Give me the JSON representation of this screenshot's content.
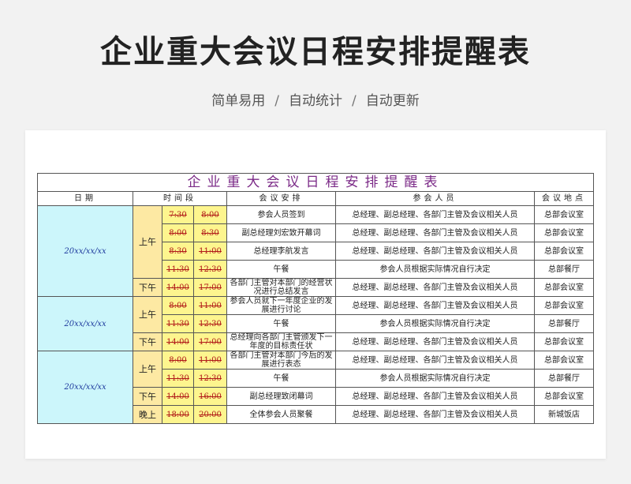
{
  "header": {
    "title": "企业重大会议日程安排提醒表",
    "subtitle": [
      "简单易用",
      "自动统计",
      "自动更新"
    ],
    "separator": "/"
  },
  "sheet": {
    "title": "企业重大会议日程安排提醒表",
    "columns": {
      "date": "日期",
      "time": "时间段",
      "agenda": "会议安排",
      "people": "参会人员",
      "location": "会议地点"
    },
    "days": [
      {
        "date": "20xx/xx/xx",
        "rows": [
          {
            "period": "上午",
            "start": "7:30",
            "end": "8:00",
            "agenda": "参会人员签到",
            "people": "总经理、副总经理、各部门主管及会议相关人员",
            "location": "总部会议室"
          },
          {
            "period": "",
            "start": "8:00",
            "end": "8:30",
            "agenda": "副总经理刘宏致开幕词",
            "people": "总经理、副总经理、各部门主管及会议相关人员",
            "location": "总部会议室"
          },
          {
            "period": "",
            "start": "8:30",
            "end": "11:00",
            "agenda": "总经理李航发言",
            "people": "总经理、副总经理、各部门主管及会议相关人员",
            "location": "总部会议室"
          },
          {
            "period": "",
            "start": "11:30",
            "end": "12:30",
            "agenda": "午餐",
            "people": "参会人员根据实际情况自行决定",
            "location": "总部餐厅"
          },
          {
            "period": "下午",
            "start": "14:00",
            "end": "17:00",
            "agenda": "各部门主管对本部门的经营状况进行总结发言",
            "people": "总经理、副总经理、各部门主管及会议相关人员",
            "location": "总部会议室"
          }
        ]
      },
      {
        "date": "20xx/xx/xx",
        "rows": [
          {
            "period": "上午",
            "start": "8:00",
            "end": "11:00",
            "agenda": "参会人员就下一年度企业的发展进行讨论",
            "people": "总经理、副总经理、各部门主管及会议相关人员",
            "location": "总部会议室"
          },
          {
            "period": "",
            "start": "11:30",
            "end": "12:30",
            "agenda": "午餐",
            "people": "参会人员根据实际情况自行决定",
            "location": "总部餐厅"
          },
          {
            "period": "下午",
            "start": "14:00",
            "end": "17:00",
            "agenda": "总经理向各部门主管颁发下一年度的目标责任状",
            "people": "总经理、副总经理、各部门主管及会议相关人员",
            "location": "总部会议室"
          }
        ]
      },
      {
        "date": "20xx/xx/xx",
        "rows": [
          {
            "period": "上午",
            "start": "8:00",
            "end": "11:00",
            "agenda": "各部门主管对本部门今后的发展进行表态",
            "people": "总经理、副总经理、各部门主管及会议相关人员",
            "location": "总部会议室"
          },
          {
            "period": "",
            "start": "11:30",
            "end": "12:30",
            "agenda": "午餐",
            "people": "参会人员根据实际情况自行决定",
            "location": "总部餐厅"
          },
          {
            "period": "下午",
            "start": "14:00",
            "end": "16:00",
            "agenda": "副总经理致闭幕词",
            "people": "总经理、副总经理、各部门主管及会议相关人员",
            "location": "总部会议室"
          },
          {
            "period": "晚上",
            "start": "18:00",
            "end": "20:00",
            "agenda": "全体参会人员聚餐",
            "people": "总经理、副总经理、各部门主管及会议相关人员",
            "location": "新城饭店"
          }
        ]
      }
    ]
  }
}
